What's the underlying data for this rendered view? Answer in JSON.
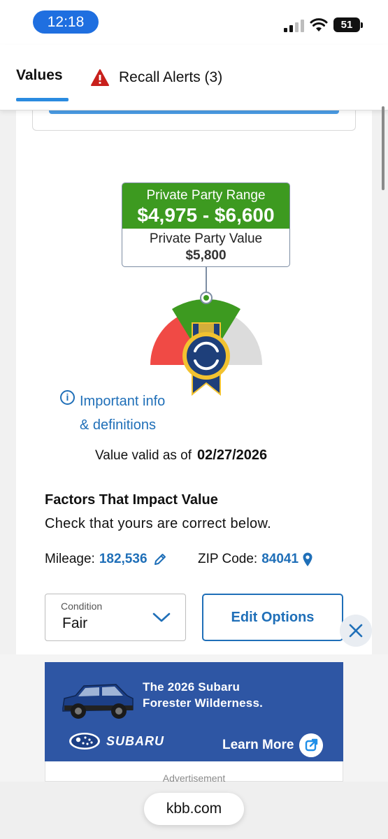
{
  "status_bar": {
    "time": "12:18",
    "battery": "51"
  },
  "tabs": {
    "values": "Values",
    "recall_alerts": "Recall Alerts (3)"
  },
  "valuation": {
    "range_label": "Private Party Range",
    "range_value": "$4,975 - $6,600",
    "value_label": "Private Party Value",
    "value_amount": "$5,800",
    "colors": {
      "range_green": "#3d9a20",
      "gauge_red": "#f04a45",
      "gauge_gray": "#dcdcdc",
      "badge_navy": "#1e3f7a",
      "badge_gold": "#f2c230"
    }
  },
  "info_link": {
    "line1": "Important info",
    "line2": "& definitions"
  },
  "validity": {
    "label": "Value valid as of",
    "date": "02/27/2026"
  },
  "factors": {
    "title": "Factors That Impact Value",
    "subtitle": "Check that yours are correct below.",
    "mileage_label": "Mileage:",
    "mileage_value": "182,536",
    "zip_label": "ZIP Code:",
    "zip_value": "84041"
  },
  "condition": {
    "label": "Condition",
    "value": "Fair"
  },
  "edit_options": "Edit Options",
  "ad": {
    "headline_line1": "The 2026 Subaru",
    "headline_line2": "Forester Wilderness.",
    "brand": "SUBARU",
    "cta": "Learn More",
    "label": "Advertisement",
    "background": "#2e56a4"
  },
  "browser": {
    "url": "kbb.com"
  },
  "accent_color": "#1f6fb8"
}
